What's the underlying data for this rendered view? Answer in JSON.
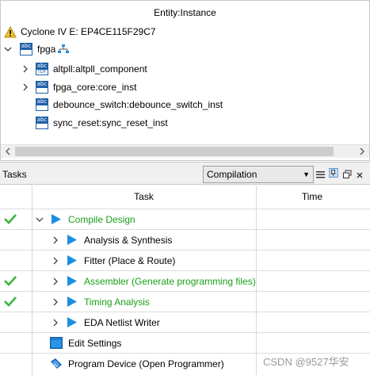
{
  "hierarchy": {
    "header": "Entity:Instance",
    "device": "Cyclone IV E: EP4CE115F29C7",
    "top": {
      "icon_text": "abc",
      "label": "fpga"
    },
    "children": [
      {
        "icon_top": "abc",
        "icon_bottom": "TDF",
        "label": "altpll:altpll_component",
        "expandable": true
      },
      {
        "icon_top": "abc",
        "icon_bottom": "",
        "label": "fpga_core:core_inst",
        "expandable": true
      },
      {
        "icon_top": "abc",
        "icon_bottom": "",
        "label": "debounce_switch:debounce_switch_inst",
        "expandable": false
      },
      {
        "icon_top": "abc",
        "icon_bottom": "",
        "label": "sync_reset:sync_reset_inst",
        "expandable": false
      }
    ]
  },
  "tasks_panel": {
    "title": "Tasks",
    "flow": "Compilation",
    "columns": {
      "task": "Task",
      "time": "Time"
    },
    "rows": [
      {
        "label": "Compile Design",
        "status": "done",
        "green": true
      },
      {
        "label": "Analysis & Synthesis",
        "status": "",
        "green": false
      },
      {
        "label": "Fitter (Place & Route)",
        "status": "",
        "green": false
      },
      {
        "label": "Assembler (Generate programming files)",
        "status": "done",
        "green": true
      },
      {
        "label": "Timing Analysis",
        "status": "done",
        "green": true
      },
      {
        "label": "EDA Netlist Writer",
        "status": "",
        "green": false
      },
      {
        "label": "Edit Settings",
        "status": "",
        "green": false
      },
      {
        "label": "Program Device (Open Programmer)",
        "status": "",
        "green": false
      }
    ]
  },
  "watermark": "CSDN @9527华安",
  "colors": {
    "green": "#18a018",
    "blue_play": "#1a8fe0",
    "icon_blue": "#1f5fa8"
  }
}
